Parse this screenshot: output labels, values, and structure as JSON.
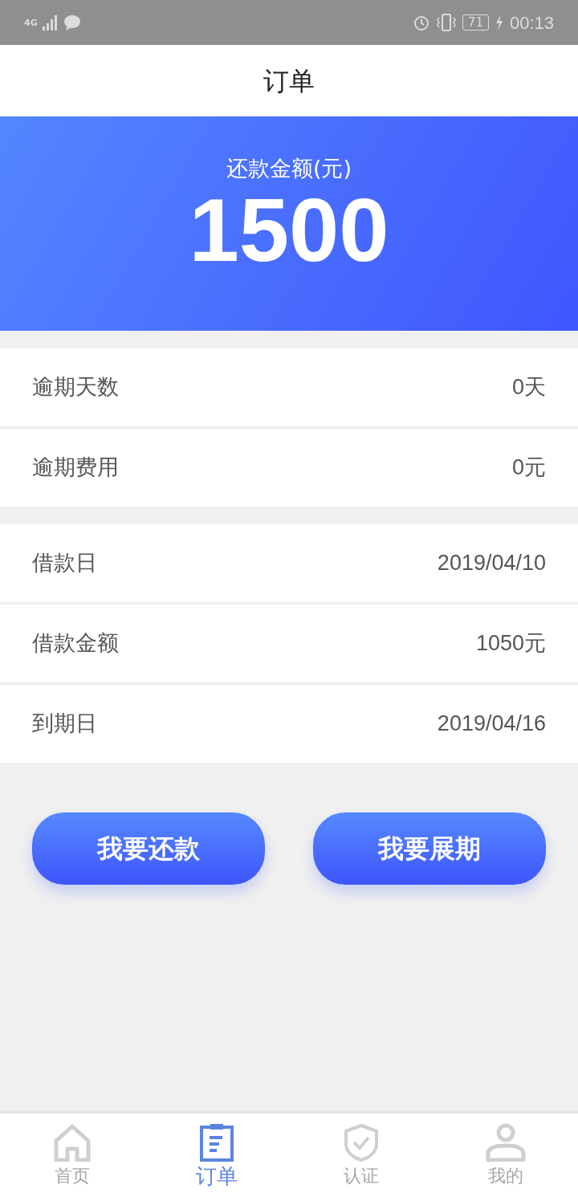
{
  "status_bar": {
    "network": "4G",
    "battery": "71",
    "time": "00:13"
  },
  "header": {
    "title": "订单"
  },
  "summary": {
    "label": "还款金额(元)",
    "amount": "1500"
  },
  "sections": [
    {
      "rows": [
        {
          "label": "逾期天数",
          "value": "0天"
        },
        {
          "label": "逾期费用",
          "value": "0元"
        }
      ]
    },
    {
      "rows": [
        {
          "label": "借款日",
          "value": "2019/04/10"
        },
        {
          "label": "借款金额",
          "value": "1050元"
        },
        {
          "label": "到期日",
          "value": "2019/04/16"
        }
      ]
    }
  ],
  "buttons": [
    "我要还款",
    "我要展期"
  ],
  "tab_bar": [
    {
      "kind": "home",
      "label": "首页",
      "selected": false
    },
    {
      "kind": "order",
      "label": "订单",
      "selected": true
    },
    {
      "kind": "verify",
      "label": "认证",
      "selected": false
    },
    {
      "kind": "profile",
      "label": "我的",
      "selected": false
    }
  ]
}
